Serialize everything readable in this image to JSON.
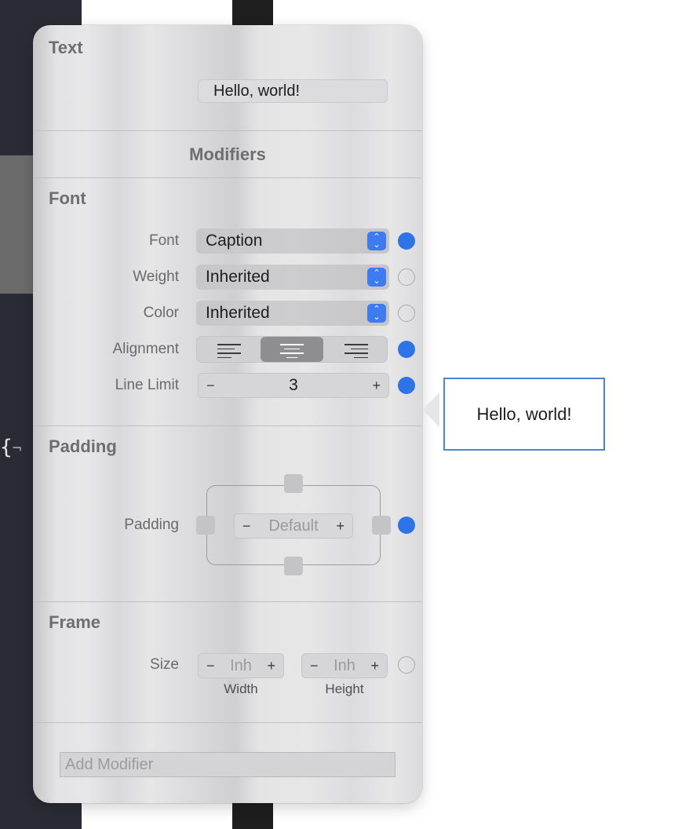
{
  "text_section": {
    "title": "Text",
    "value": "Hello, world!"
  },
  "modifiers_title": "Modifiers",
  "font_section": {
    "title": "Font",
    "font": {
      "label": "Font",
      "value": "Caption",
      "active": true
    },
    "weight": {
      "label": "Weight",
      "value": "Inherited",
      "active": false
    },
    "color": {
      "label": "Color",
      "value": "Inherited",
      "active": false
    },
    "alignment": {
      "label": "Alignment",
      "options": [
        "left",
        "center",
        "right"
      ],
      "selected": "center",
      "active": true
    },
    "line_limit": {
      "label": "Line Limit",
      "value": "3",
      "minus": "−",
      "plus": "+",
      "active": true
    }
  },
  "padding_section": {
    "title": "Padding",
    "label": "Padding",
    "value": "Default",
    "minus": "−",
    "plus": "+",
    "active": true
  },
  "frame_section": {
    "title": "Frame",
    "label": "Size",
    "width": {
      "value": "Inh",
      "caption": "Width",
      "minus": "−",
      "plus": "+"
    },
    "height": {
      "value": "Inh",
      "caption": "Height",
      "minus": "−",
      "plus": "+"
    },
    "active": false
  },
  "add_modifier_placeholder": "Add Modifier",
  "preview": {
    "text": "Hello, world!"
  },
  "code_fragment": "{",
  "colors": {
    "accent": "#2f74e6",
    "preview_border": "#4a86d4"
  }
}
